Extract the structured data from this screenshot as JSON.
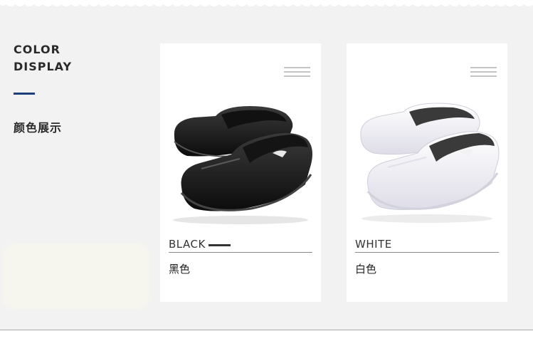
{
  "section": {
    "heading_line1": "COLOR",
    "heading_line2": "DISPLAY",
    "subtitle_cn": "颜色展示",
    "accent_color": "#1f3f7a"
  },
  "products": [
    {
      "color_name": "BLACK",
      "color_cn": "黑色",
      "shoe_color": "#1a1a1a"
    },
    {
      "color_name": "WHITE",
      "color_cn": "白色",
      "shoe_color": "#f1f1f7"
    }
  ]
}
